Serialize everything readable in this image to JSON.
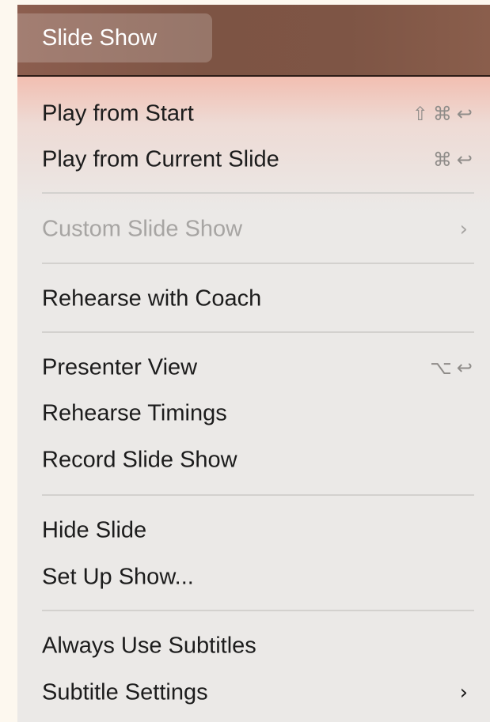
{
  "menubar": {
    "title": "Slide Show"
  },
  "menu": {
    "items": [
      {
        "label": "Play from Start",
        "shortcut": [
          "⇧",
          "⌘",
          "↩"
        ],
        "enabled": true
      },
      {
        "label": "Play from Current Slide",
        "shortcut": [
          "⌘",
          "↩"
        ],
        "enabled": true
      },
      {
        "label": "Custom Slide Show",
        "submenu": true,
        "chevron": "›",
        "enabled": false
      },
      {
        "label": "Rehearse with Coach",
        "enabled": true
      },
      {
        "label": "Presenter View",
        "shortcut": [
          "⌥",
          "↩"
        ],
        "enabled": true
      },
      {
        "label": "Rehearse Timings",
        "enabled": true
      },
      {
        "label": "Record Slide Show",
        "enabled": true
      },
      {
        "label": "Hide Slide",
        "enabled": true
      },
      {
        "label": "Set Up Show...",
        "enabled": true
      },
      {
        "label": "Always Use Subtitles",
        "enabled": true
      },
      {
        "label": "Subtitle Settings",
        "submenu": true,
        "chevron": "›",
        "enabled": true
      }
    ]
  },
  "colors": {
    "menubar": "#7e5545",
    "menu_background": "#ebe9e7",
    "text": "#1c1c1c",
    "disabled_text": "#a7a5a3",
    "separator": "#d3d1ce"
  }
}
